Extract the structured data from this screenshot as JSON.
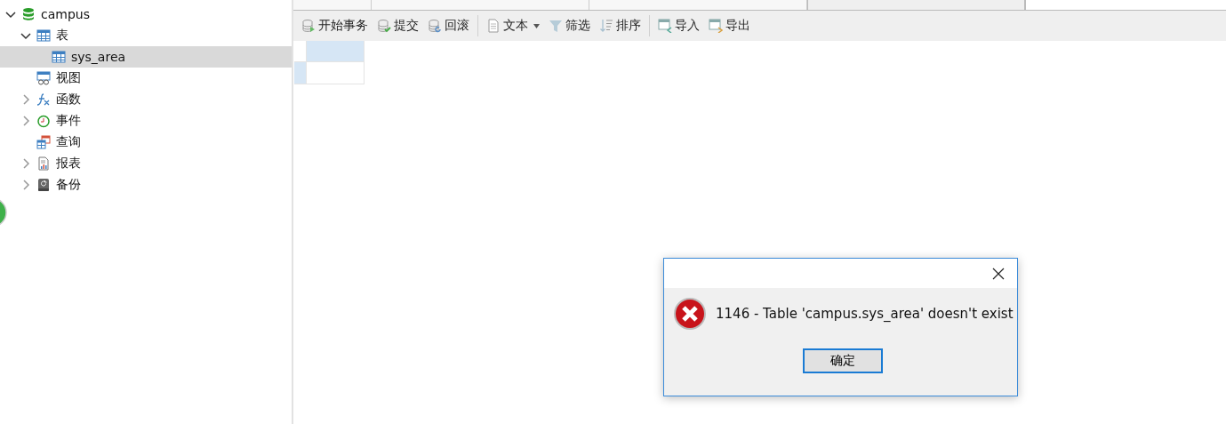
{
  "tree": [
    {
      "label": "campus",
      "kind": "database",
      "selected": false,
      "expanded": true,
      "children": [
        {
          "label": "表",
          "kind": "table",
          "selected": false,
          "expanded": true,
          "children": [
            {
              "label": "sys_area",
              "kind": "table",
              "selected": true
            }
          ]
        },
        {
          "label": "视图",
          "kind": "view",
          "selected": false
        },
        {
          "label": "函数",
          "kind": "function",
          "selected": false,
          "expanded": false
        },
        {
          "label": "事件",
          "kind": "clock",
          "selected": false,
          "expanded": false
        },
        {
          "label": "查询",
          "kind": "query",
          "selected": false
        },
        {
          "label": "报表",
          "kind": "report",
          "selected": false,
          "expanded": false
        },
        {
          "label": "备份",
          "kind": "backup",
          "selected": false,
          "expanded": false
        }
      ]
    }
  ],
  "tabs": [
    {
      "selected": false
    },
    {
      "selected": false
    },
    {
      "selected": false
    },
    {
      "selected": true
    }
  ],
  "toolbar": [
    [
      {
        "label": "开始事务",
        "kind": "start"
      },
      {
        "label": "提交",
        "kind": "commit"
      },
      {
        "label": "回滚",
        "kind": "rollback"
      }
    ],
    [
      {
        "label": "文本",
        "kind": "doc",
        "dropdown": true
      },
      {
        "label": "筛选",
        "kind": "filter",
        "dropdown": false
      },
      {
        "label": "排序",
        "kind": "sort",
        "dropdown": false
      }
    ],
    [
      {
        "label": "导入",
        "kind": "import"
      },
      {
        "label": "导出",
        "kind": "export"
      }
    ]
  ],
  "dialog": {
    "message": "1146 - Table 'campus.sys_area' doesn't exist",
    "button": "确定"
  }
}
